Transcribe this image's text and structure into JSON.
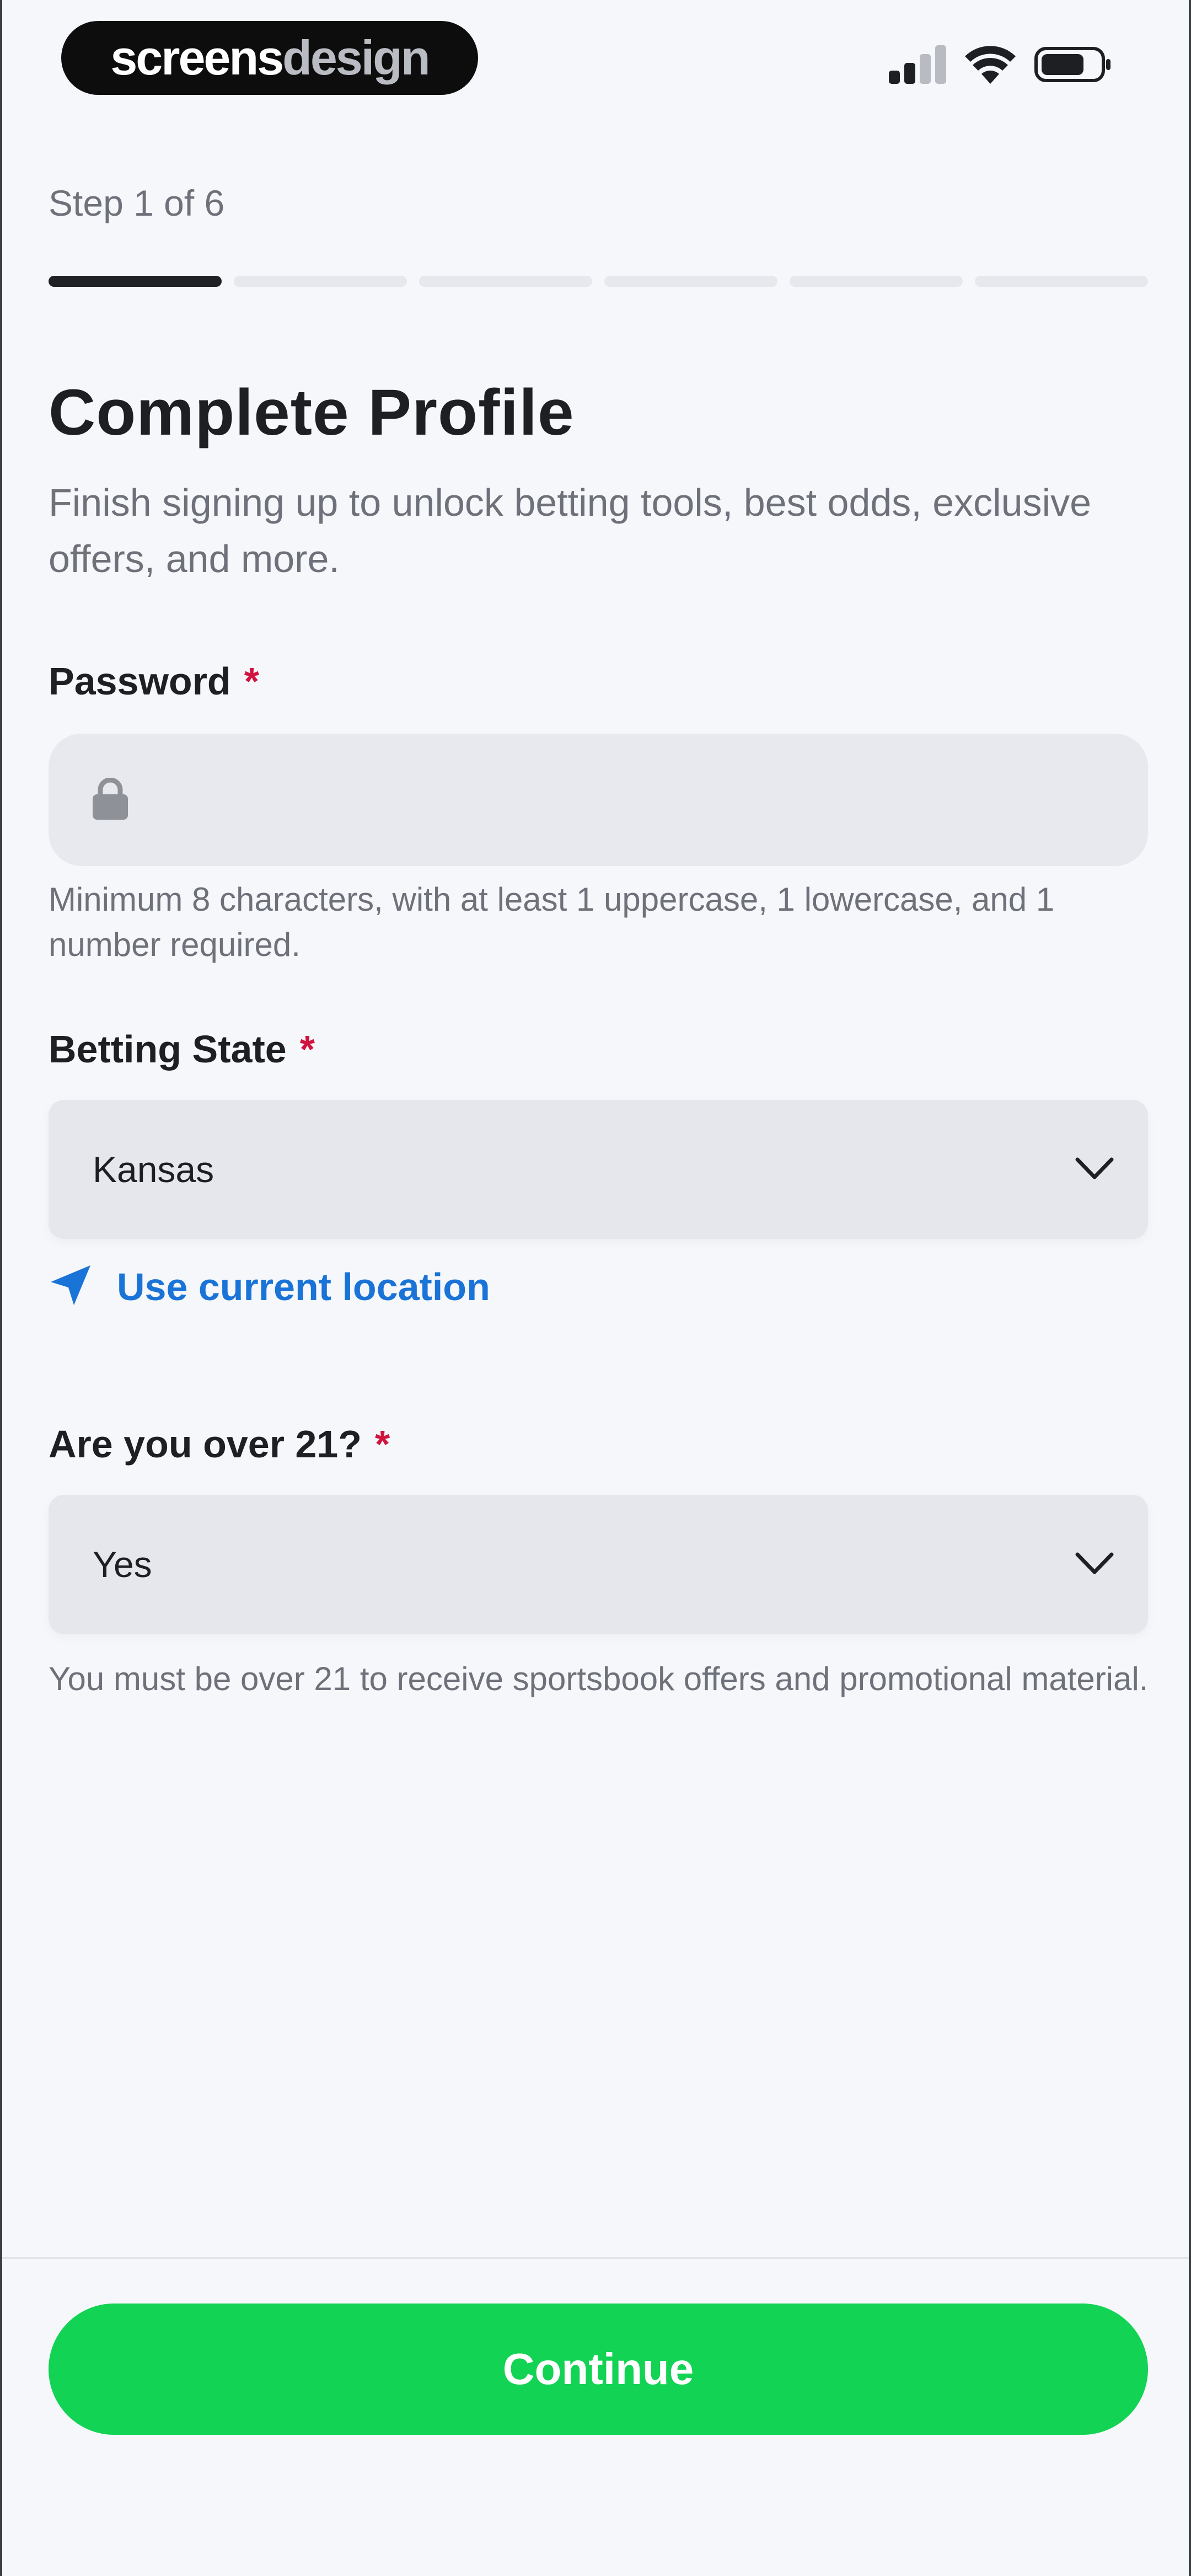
{
  "status_bar": {
    "brand_part1": "screens",
    "brand_part2": "design",
    "icons": [
      "cellular-signal-icon",
      "wifi-icon",
      "battery-icon"
    ]
  },
  "progress": {
    "step_label": "Step 1 of 6",
    "current_step": 1,
    "total_steps": 6
  },
  "header": {
    "title": "Complete Profile",
    "subtitle": "Finish signing up to unlock betting tools, best odds, exclusive offers, and more."
  },
  "password": {
    "label": "Password",
    "required_mark": "*",
    "value": "",
    "icon": "lock-icon",
    "helper": "Minimum 8 characters, with at least 1 uppercase, 1 lowercase, and 1 number required."
  },
  "betting_state": {
    "label": "Betting State",
    "required_mark": "*",
    "value": "Kansas",
    "icon": "chevron-down-icon"
  },
  "location": {
    "label": "Use current location",
    "icon": "location-arrow-icon"
  },
  "age": {
    "label": "Are you over 21?",
    "required_mark": "*",
    "value": "Yes",
    "icon": "chevron-down-icon",
    "helper": "You must be over 21 to receive sportsbook offers and promotional material."
  },
  "footer": {
    "continue_label": "Continue"
  },
  "colors": {
    "accent_green": "#12d353",
    "link_blue": "#1a73d6",
    "required_red": "#d0143e",
    "progress_active": "#1f2124"
  }
}
